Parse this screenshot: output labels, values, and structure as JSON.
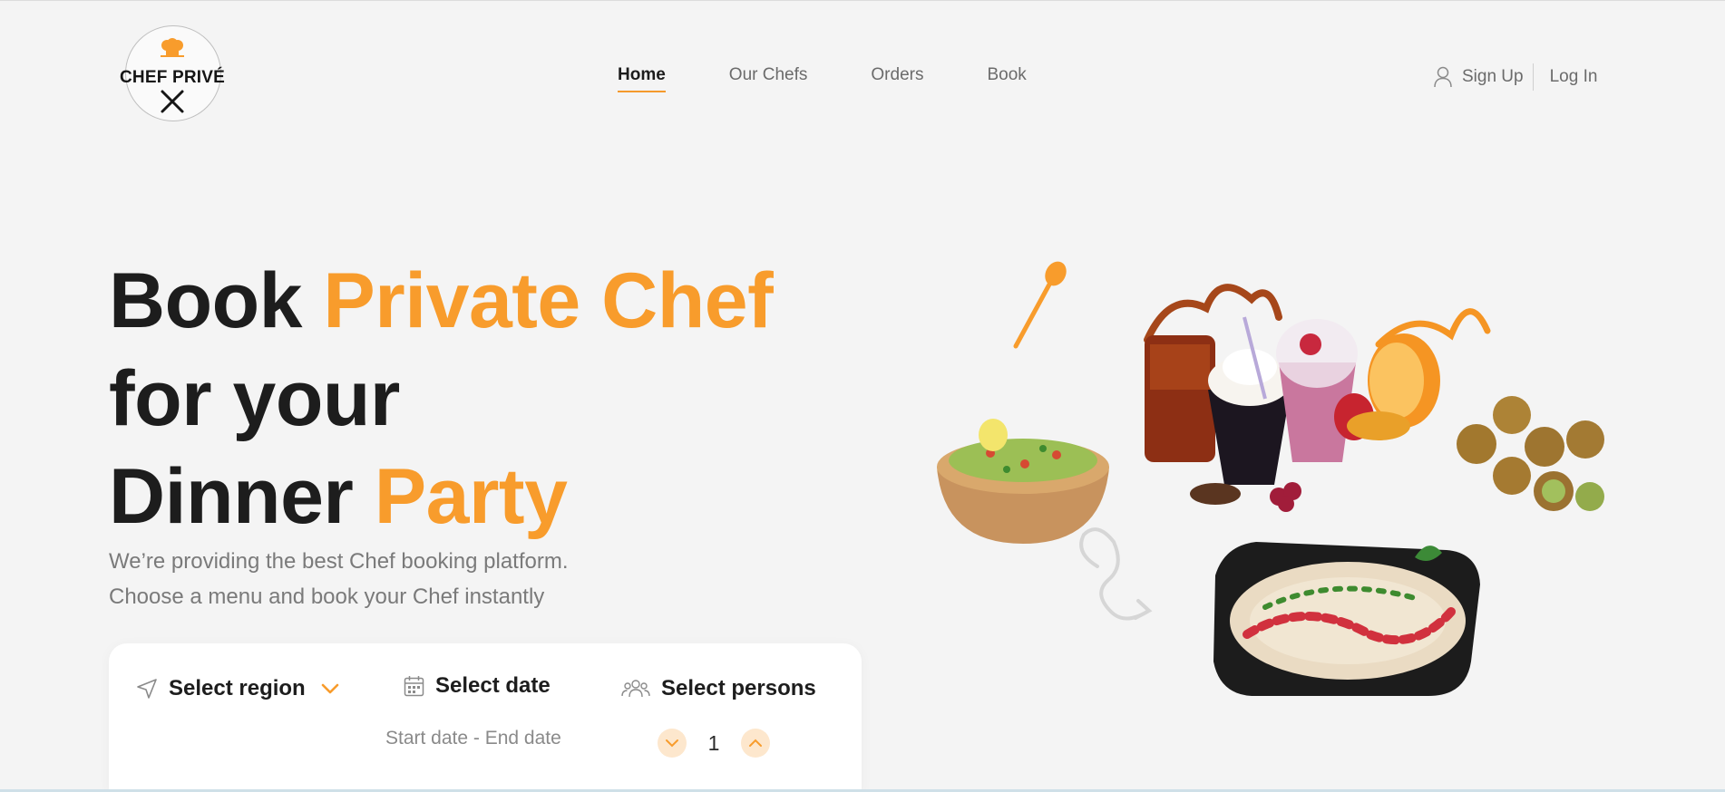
{
  "brand": {
    "name": "CHEF PRIVÉ"
  },
  "nav": {
    "items": [
      {
        "label": "Home",
        "active": true
      },
      {
        "label": "Our Chefs",
        "active": false
      },
      {
        "label": "Orders",
        "active": false
      },
      {
        "label": "Book",
        "active": false
      }
    ]
  },
  "auth": {
    "signup": "Sign Up",
    "login": "Log In"
  },
  "hero": {
    "line1_a": "Book ",
    "line1_b": "Private Chef",
    "line2": "for your",
    "line3_a": "Dinner ",
    "line3_b": "Party",
    "sub1": "We’re providing the best Chef booking platform.",
    "sub2": "Choose a menu and book your Chef instantly"
  },
  "search": {
    "region_label": "Select region",
    "date_label": "Select date",
    "date_range": "Start date - End date",
    "persons_label": "Select persons",
    "persons_value": "1"
  },
  "colors": {
    "accent": "#f89c2c",
    "text": "#1d1d1d",
    "muted": "#7a7a7a",
    "background": "#f4f4f4"
  },
  "icons": [
    "chef-hat-icon",
    "crossed-utensils-icon",
    "user-icon",
    "navigation-arrow-icon",
    "chevron-down-icon",
    "calendar-icon",
    "people-icon",
    "chevron-up-icon"
  ]
}
